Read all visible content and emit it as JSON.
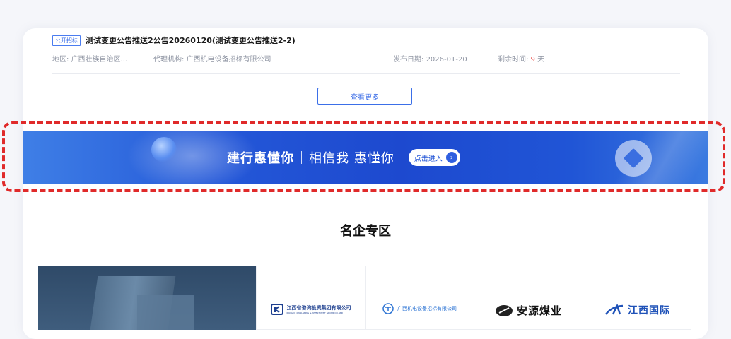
{
  "tender_item": {
    "tag": "公开招标",
    "title": "测试变更公告推送2公告20260120(测试变更公告推送2-2)",
    "region_label": "地区:",
    "region_value": "广西壮族自治区...",
    "agency_label": "代理机构:",
    "agency_value": "广西机电设备招标有限公司",
    "publish_label": "发布日期:",
    "publish_value": "2026-01-20",
    "remaining_label": "剩余时间:",
    "remaining_days": "9",
    "remaining_unit": "天"
  },
  "more_button": {
    "label": "查看更多"
  },
  "banner": {
    "brand": "建行惠懂你",
    "slogan": "相信我 惠懂你",
    "enter_label": "点击进入",
    "enter_icon": "arrow-right-icon",
    "logo_icon": "ccb-logo-icon"
  },
  "highlight": {
    "color": "#e02a2a",
    "style": "dashed"
  },
  "section": {
    "title": "名企专区"
  },
  "partners": [
    {
      "name_cn": "江西省咨询投资集团有限公司",
      "name_en": "JIANGXI CONSULTING & INVESTMENT GROUP CO.,LTD",
      "icon": "jxci-logo-icon"
    },
    {
      "name_cn": "广西机电设备招标有限公司",
      "icon": "gx-tender-logo-icon"
    },
    {
      "name_cn": "安源煤业",
      "icon": "anyuan-logo-icon"
    },
    {
      "name_cn": "江西国际",
      "icon": "jx-international-logo-icon"
    }
  ],
  "colors": {
    "accent": "#3b6fe8",
    "banner": "#2458d8",
    "remaining_highlight": "#e53935",
    "meta_text": "#8f95a3"
  }
}
